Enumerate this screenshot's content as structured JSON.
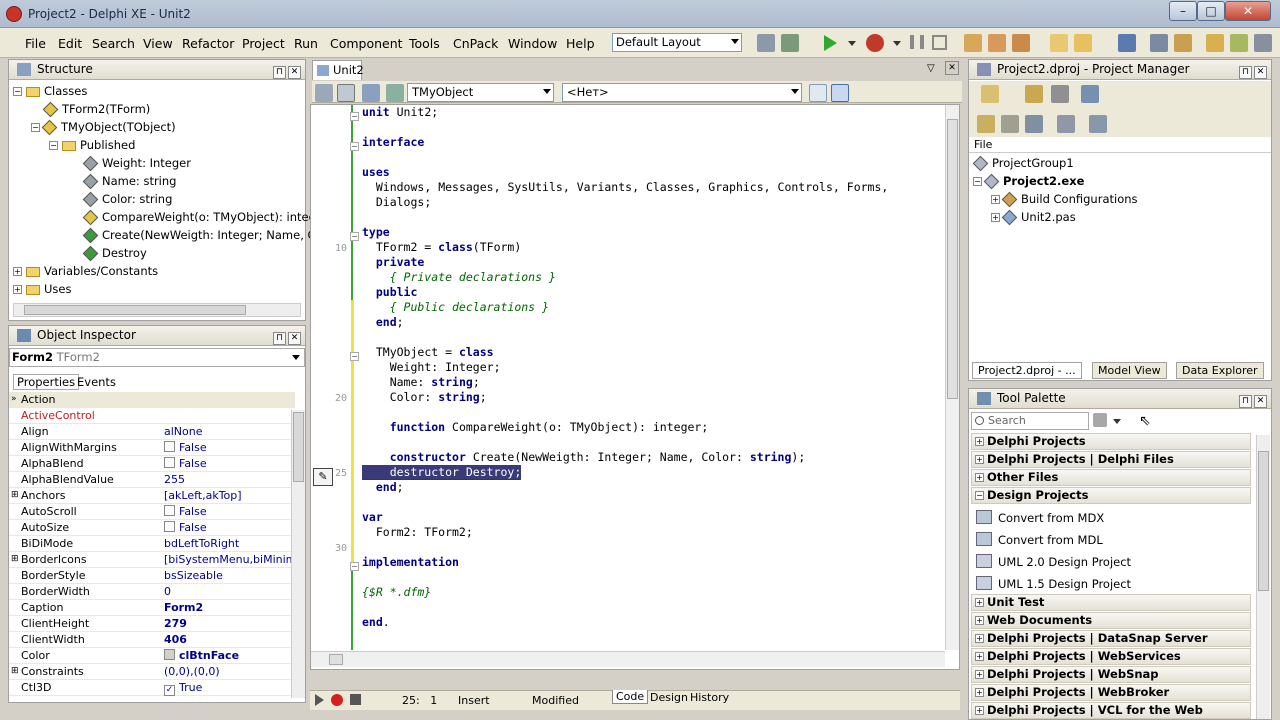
{
  "window": {
    "title": "Project2 - Delphi XE - Unit2"
  },
  "menu": [
    "File",
    "Edit",
    "Search",
    "View",
    "Refactor",
    "Project",
    "Run",
    "Component",
    "Tools",
    "CnPack",
    "Window",
    "Help"
  ],
  "layout": "Default Layout",
  "structure": {
    "title": "Structure",
    "items": [
      "Classes",
      "TForm2(TForm)",
      "TMyObject(TObject)",
      "Published",
      "Weight: Integer",
      "Name: string",
      "Color: string",
      "CompareWeight(o: TMyObject): integer",
      "Create(NewWeigth: Integer; Name, Color:",
      "Destroy",
      "Variables/Constants",
      "Uses"
    ]
  },
  "inspector": {
    "title": "Object Inspector",
    "object": "Form2",
    "object_type": "TForm2",
    "tabs": [
      "Properties",
      "Events"
    ],
    "rows": [
      [
        "Action",
        ""
      ],
      [
        "ActiveControl",
        ""
      ],
      [
        "Align",
        "alNone"
      ],
      [
        "AlignWithMargins",
        "False"
      ],
      [
        "AlphaBlend",
        "False"
      ],
      [
        "AlphaBlendValue",
        "255"
      ],
      [
        "Anchors",
        "[akLeft,akTop]"
      ],
      [
        "AutoScroll",
        "False"
      ],
      [
        "AutoSize",
        "False"
      ],
      [
        "BiDiMode",
        "bdLeftToRight"
      ],
      [
        "BorderIcons",
        "[biSystemMenu,biMinimize,b"
      ],
      [
        "BorderStyle",
        "bsSizeable"
      ],
      [
        "BorderWidth",
        "0"
      ],
      [
        "Caption",
        "Form2"
      ],
      [
        "ClientHeight",
        "279"
      ],
      [
        "ClientWidth",
        "406"
      ],
      [
        "Color",
        "clBtnFace"
      ],
      [
        "Constraints",
        "(0,0),(0,0)"
      ],
      [
        "Ctl3D",
        "True"
      ]
    ]
  },
  "editor": {
    "tab": "Unit2",
    "class_select": "TMyObject",
    "method_select": "<Нет>",
    "line_numbers": [
      "10",
      "20",
      "25",
      "30"
    ],
    "code": [
      "unit Unit2;",
      "",
      "interface",
      "",
      "uses",
      "  Windows, Messages, SysUtils, Variants, Classes, Graphics, Controls, Forms,",
      "  Dialogs;",
      "",
      "type",
      "  TForm2 = class(TForm)",
      "  private",
      "    { Private declarations }",
      "  public",
      "    { Public declarations }",
      "  end;",
      "",
      "  TMyObject = class",
      "    Weight: Integer;",
      "    Name: string;",
      "    Color: string;",
      "",
      "    function CompareWeight(o: TMyObject): integer;",
      "",
      "    constructor Create(NewWeigth: Integer; Name, Color: string);",
      "    destructor Destroy;",
      "  end;",
      "",
      "var",
      "  Form2: TForm2;",
      "",
      "implementation",
      "",
      "{$R *.dfm}",
      "",
      "end."
    ],
    "status": {
      "position": "25:   1",
      "mode": "Insert",
      "state": "Modified"
    },
    "bottom_tabs": [
      "Code",
      "Design",
      "History"
    ]
  },
  "project_manager": {
    "title": "Project2.dproj - Project Manager",
    "header": "File",
    "items": [
      "ProjectGroup1",
      "Project2.exe",
      "Build Configurations",
      "Unit2.pas"
    ],
    "tabs": [
      "Project2.dproj - ...",
      "Model View",
      "Data Explorer"
    ]
  },
  "tool_palette": {
    "title": "Tool Palette",
    "search_placeholder": "Search",
    "categories": [
      {
        "label": "Delphi Projects",
        "sign": "+"
      },
      {
        "label": "Delphi Projects | Delphi Files",
        "sign": "+"
      },
      {
        "label": "Other Files",
        "sign": "+"
      },
      {
        "label": "Design Projects",
        "sign": "−"
      }
    ],
    "design_items": [
      "Convert from MDX",
      "Convert from MDL",
      "UML 2.0 Design Project",
      "UML 1.5 Design Project"
    ],
    "more_categories": [
      "Unit Test",
      "Web Documents",
      "Delphi Projects | DataSnap Server",
      "Delphi Projects | WebServices",
      "Delphi Projects | WebSnap",
      "Delphi Projects | WebBroker",
      "Delphi Projects | VCL for the Web"
    ]
  }
}
